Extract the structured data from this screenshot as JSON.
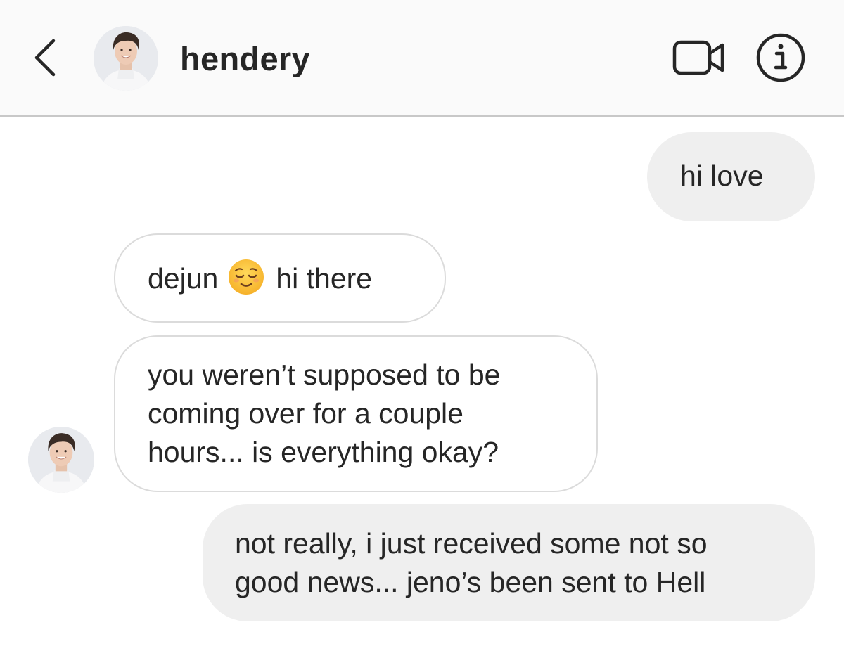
{
  "header": {
    "username": "hendery",
    "back_icon": "chevron-left-icon",
    "video_icon": "video-camera-icon",
    "info_icon": "info-icon"
  },
  "messages": [
    {
      "from": "me",
      "text": "hi love"
    },
    {
      "from": "them",
      "before_emoji": "dejun",
      "emoji": "relieved-face-emoji",
      "after_emoji": "hi there"
    },
    {
      "from": "them",
      "lines": [
        "you weren’t supposed to be",
        "coming over for a couple",
        "hours... is everything okay?"
      ]
    },
    {
      "from": "me",
      "lines": [
        "not really, i just received some not so",
        "good news... jeno’s been sent to Hell"
      ]
    }
  ],
  "colors": {
    "header_bg": "#fafafa",
    "sent_bubble": "#efefef",
    "received_border": "#dbdbdb",
    "text": "#262626"
  }
}
